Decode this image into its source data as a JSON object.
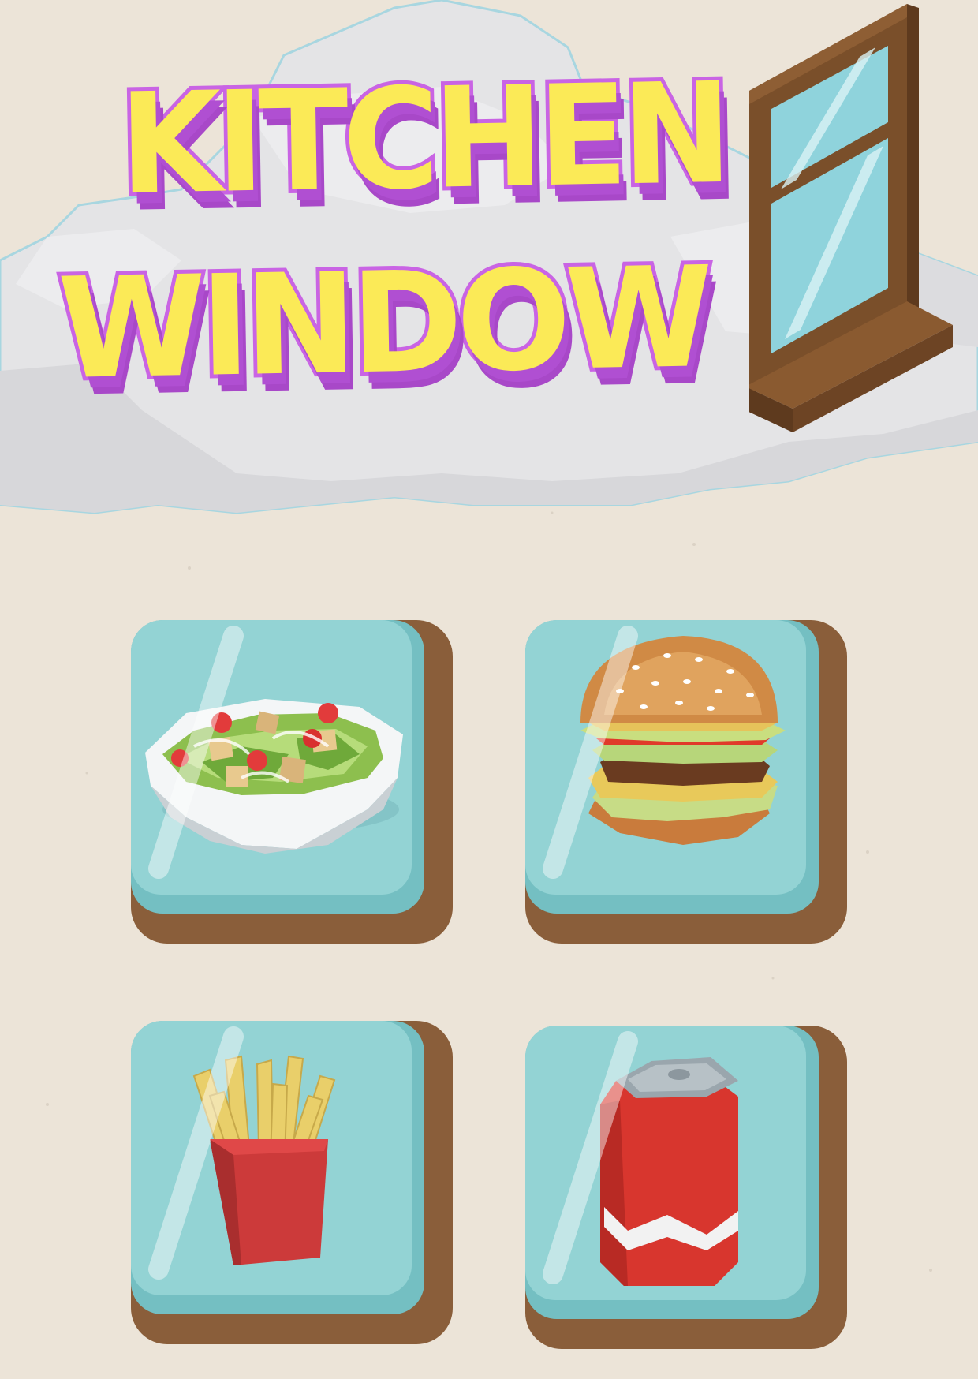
{
  "title": {
    "line1": "KITCHEN",
    "line2": "WINDOW"
  },
  "colors": {
    "background": "#ece4d8",
    "title_fill": "#fbea57",
    "title_outline": "#c964e4",
    "tile_face": "#93d3d4",
    "tile_base": "#8a5e3a",
    "window_frame": "#7a4f2a",
    "window_glass": "#8fd3dc"
  },
  "tiles": [
    {
      "item": "salad",
      "icon": "salad-bowl-icon"
    },
    {
      "item": "burger",
      "icon": "burger-icon"
    },
    {
      "item": "fries",
      "icon": "french-fries-icon"
    },
    {
      "item": "soda",
      "icon": "soda-can-icon"
    }
  ]
}
